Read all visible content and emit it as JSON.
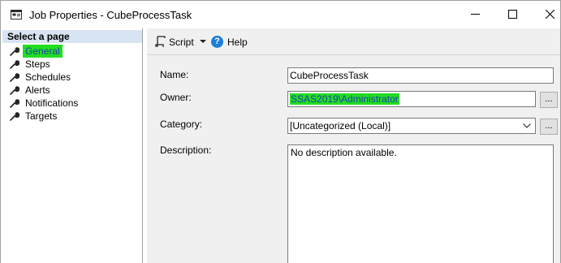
{
  "window": {
    "title": "Job Properties - CubeProcessTask"
  },
  "sidebar": {
    "header": "Select a page",
    "items": [
      {
        "label": "General",
        "selected": true
      },
      {
        "label": "Steps"
      },
      {
        "label": "Schedules"
      },
      {
        "label": "Alerts"
      },
      {
        "label": "Notifications"
      },
      {
        "label": "Targets"
      }
    ]
  },
  "toolbar": {
    "script_label": "Script",
    "help_label": "Help"
  },
  "form": {
    "name_label": "Name:",
    "name_value": "CubeProcessTask",
    "owner_label": "Owner:",
    "owner_value": "SSAS2019\\Administrator",
    "owner_browse": "...",
    "category_label": "Category:",
    "category_value": "[Uncategorized (Local)]",
    "category_browse": "...",
    "description_label": "Description:",
    "description_value": "No description available."
  },
  "colors": {
    "highlight": "#22dd22",
    "highlight_text": "#1f3fb0",
    "header_bg": "#d9e4f2",
    "panel_bg": "#f0f0f0"
  }
}
